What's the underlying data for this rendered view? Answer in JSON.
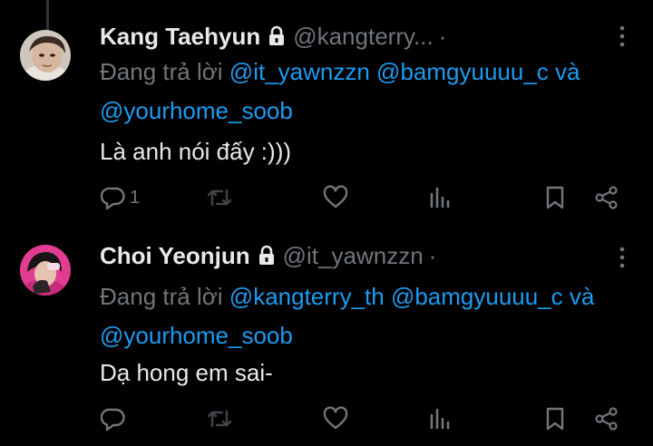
{
  "tweets": [
    {
      "display_name": "Kang Taehyun",
      "handle": "@kangterry...",
      "separator": "·",
      "reply_prefix": "Đang trả lời",
      "mention_1": "@it_yawnzzn",
      "mention_2": "@bamgyuuuu_c",
      "conjunction": "và",
      "mention_3": "@yourhome_soob",
      "text": "Là anh nói đấy :)))",
      "reply_count": "1",
      "icons": [
        "lock-icon",
        "more-icon",
        "reply-icon",
        "repost-icon",
        "like-icon",
        "views-icon",
        "bookmark-icon",
        "share-icon"
      ]
    },
    {
      "display_name": "Choi Yeonjun",
      "handle": "@it_yawnzzn",
      "separator": "·",
      "reply_prefix": "Đang trả lời",
      "mention_1": "@kangterry_th",
      "mention_2": "@bamgyuuuu_c",
      "conjunction": "và",
      "mention_3": "@yourhome_soob",
      "text": "Dạ hong em sai-",
      "reply_count": "",
      "icons": [
        "lock-icon",
        "more-icon",
        "reply-icon",
        "repost-icon",
        "like-icon",
        "views-icon",
        "bookmark-icon",
        "share-icon"
      ]
    }
  ],
  "colors": {
    "background": "#000000",
    "primary_text": "#e7e9ea",
    "secondary_text": "#71767b",
    "mention": "#1d9bf0"
  }
}
